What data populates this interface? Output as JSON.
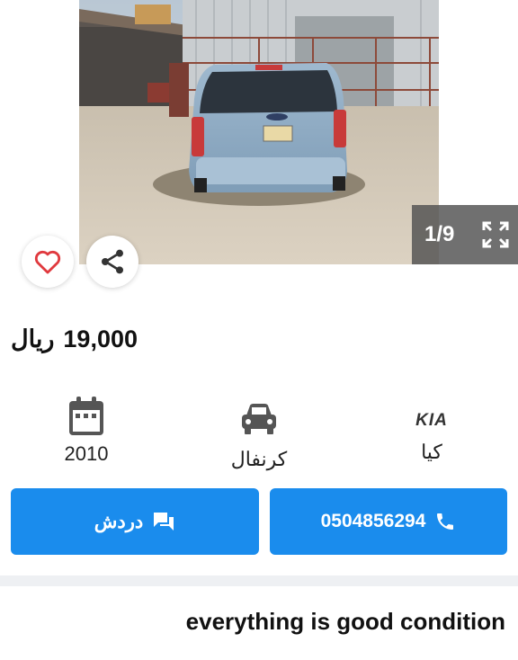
{
  "gallery": {
    "counter": "1/9",
    "image_subject": "blue Kia Carnival van parked in a sandy yard"
  },
  "listing": {
    "price_amount": "19,000",
    "price_currency": "ريال"
  },
  "specs": {
    "year": "2010",
    "model": "كرنفال",
    "brand": "كيا",
    "brand_logo_text": "KIA"
  },
  "actions": {
    "chat_label": "دردش",
    "phone_number": "0504856294"
  },
  "description": {
    "text": "everything is good condition"
  },
  "colors": {
    "accent": "#1a8ced",
    "favorite": "#e0393e"
  }
}
